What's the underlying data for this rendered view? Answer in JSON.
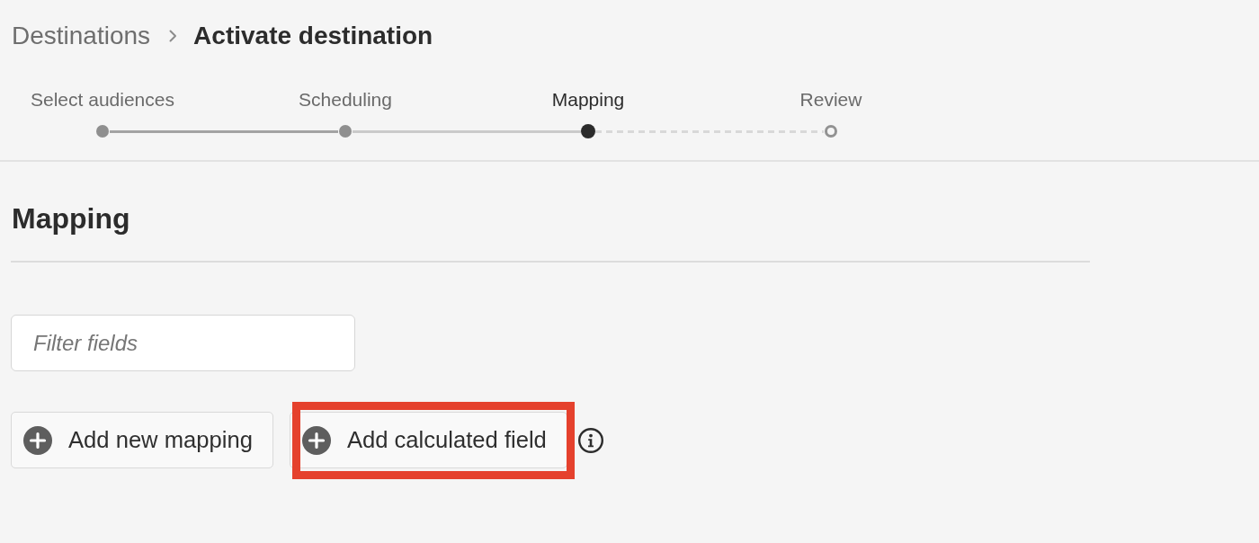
{
  "breadcrumb": [
    {
      "label": "Destinations",
      "current": false
    },
    {
      "label": "Activate destination",
      "current": true
    }
  ],
  "steps": [
    {
      "label": "Select audiences",
      "completed": true,
      "selected": false
    },
    {
      "label": "Scheduling",
      "completed": true,
      "selected": false
    },
    {
      "label": "Mapping",
      "completed": false,
      "selected": true
    },
    {
      "label": "Review",
      "completed": false,
      "selected": false
    }
  ],
  "section": {
    "title": "Mapping"
  },
  "filter": {
    "placeholder": "Filter fields"
  },
  "actions": [
    {
      "label": "Add new mapping",
      "highlighted": false,
      "info": false
    },
    {
      "label": "Add calculated field",
      "highlighted": true,
      "info": true
    }
  ]
}
